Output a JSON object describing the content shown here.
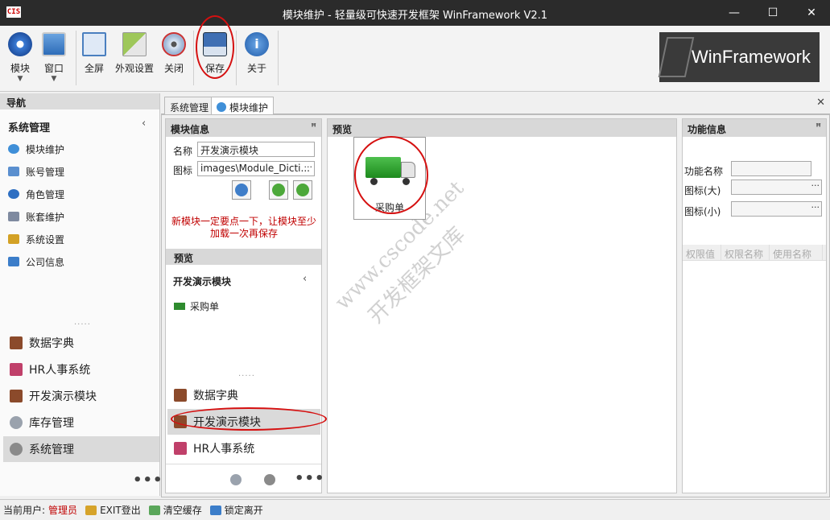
{
  "window": {
    "app_icon_text": "CIS",
    "title": "模块维护 - 轻量级可快速开发框架 WinFramework V2.1",
    "minimize": "—",
    "maximize": "☐",
    "close": "✕"
  },
  "ribbon": {
    "buttons": [
      {
        "label": "模块",
        "icon": "compass-icon"
      },
      {
        "label": "窗口",
        "icon": "window-icon"
      },
      {
        "label": "全屏",
        "icon": "fullscreen-icon"
      },
      {
        "label": "外观设置",
        "icon": "appearance-icon"
      },
      {
        "label": "关闭",
        "icon": "eye-off-icon"
      },
      {
        "label": "保存",
        "icon": "save-icon"
      },
      {
        "label": "关于",
        "icon": "info-icon"
      }
    ],
    "brand_text": "WinFramework"
  },
  "nav": {
    "header": "导航",
    "title": "系统管理",
    "collapse": "‹",
    "items": [
      {
        "label": "模块维护",
        "icon": "gear-blue-icon"
      },
      {
        "label": "账号管理",
        "icon": "users-icon"
      },
      {
        "label": "角色管理",
        "icon": "role-icon"
      },
      {
        "label": "账套维护",
        "icon": "database-icon"
      },
      {
        "label": "系统设置",
        "icon": "settings-icon"
      },
      {
        "label": "公司信息",
        "icon": "company-icon"
      }
    ],
    "grip": "·····",
    "groups": [
      {
        "label": "数据字典",
        "icon": "book-icon"
      },
      {
        "label": "HR人事系统",
        "icon": "hr-icon"
      },
      {
        "label": "开发演示模块",
        "icon": "book-icon"
      },
      {
        "label": "库存管理",
        "icon": "stack-icon"
      },
      {
        "label": "系统管理",
        "icon": "gear-icon"
      }
    ],
    "more": "•••"
  },
  "tabs": [
    {
      "label": "系统管理"
    },
    {
      "label": "模块维护"
    }
  ],
  "tab_close": "✕",
  "module_info": {
    "header": "模块信息",
    "pin": "ꟸ",
    "name_label": "名称",
    "name_value": "开发演示模块",
    "icon_label": "图标",
    "icon_value": "images\\Module_Dicti...",
    "ellipsis": "···",
    "warning_line1": "新模块一定要点一下，让模块至少",
    "warning_line2": "加载一次再保存",
    "preview_header": "预览",
    "preview_title": "开发演示模块",
    "preview_collapse": "‹",
    "preview_item": "采购单",
    "grip": "·····",
    "groups": [
      "数据字典",
      "开发演示模块",
      "HR人事系统"
    ],
    "more": "•••"
  },
  "preview": {
    "header": "预览",
    "tile_label": "采购单"
  },
  "watermark": {
    "line1": "www.cscode.net",
    "line2": "开发框架文库"
  },
  "function_info": {
    "header": "功能信息",
    "pin": "ꟸ",
    "name_label": "功能名称",
    "icon_large_label": "图标(大)",
    "icon_small_label": "图标(小)",
    "ellipsis": "···",
    "grid_columns": [
      "权限值",
      "权限名称",
      "使用名称"
    ]
  },
  "status": {
    "current_user_label": "当前用户:",
    "current_user": "管理员",
    "exit": "EXIT登出",
    "clear_cache": "清空缓存",
    "lock": "锁定离开"
  },
  "colors": {
    "title_bg": "#2b2b2b",
    "accent_red": "#d51010",
    "warning_red": "#c00000"
  }
}
